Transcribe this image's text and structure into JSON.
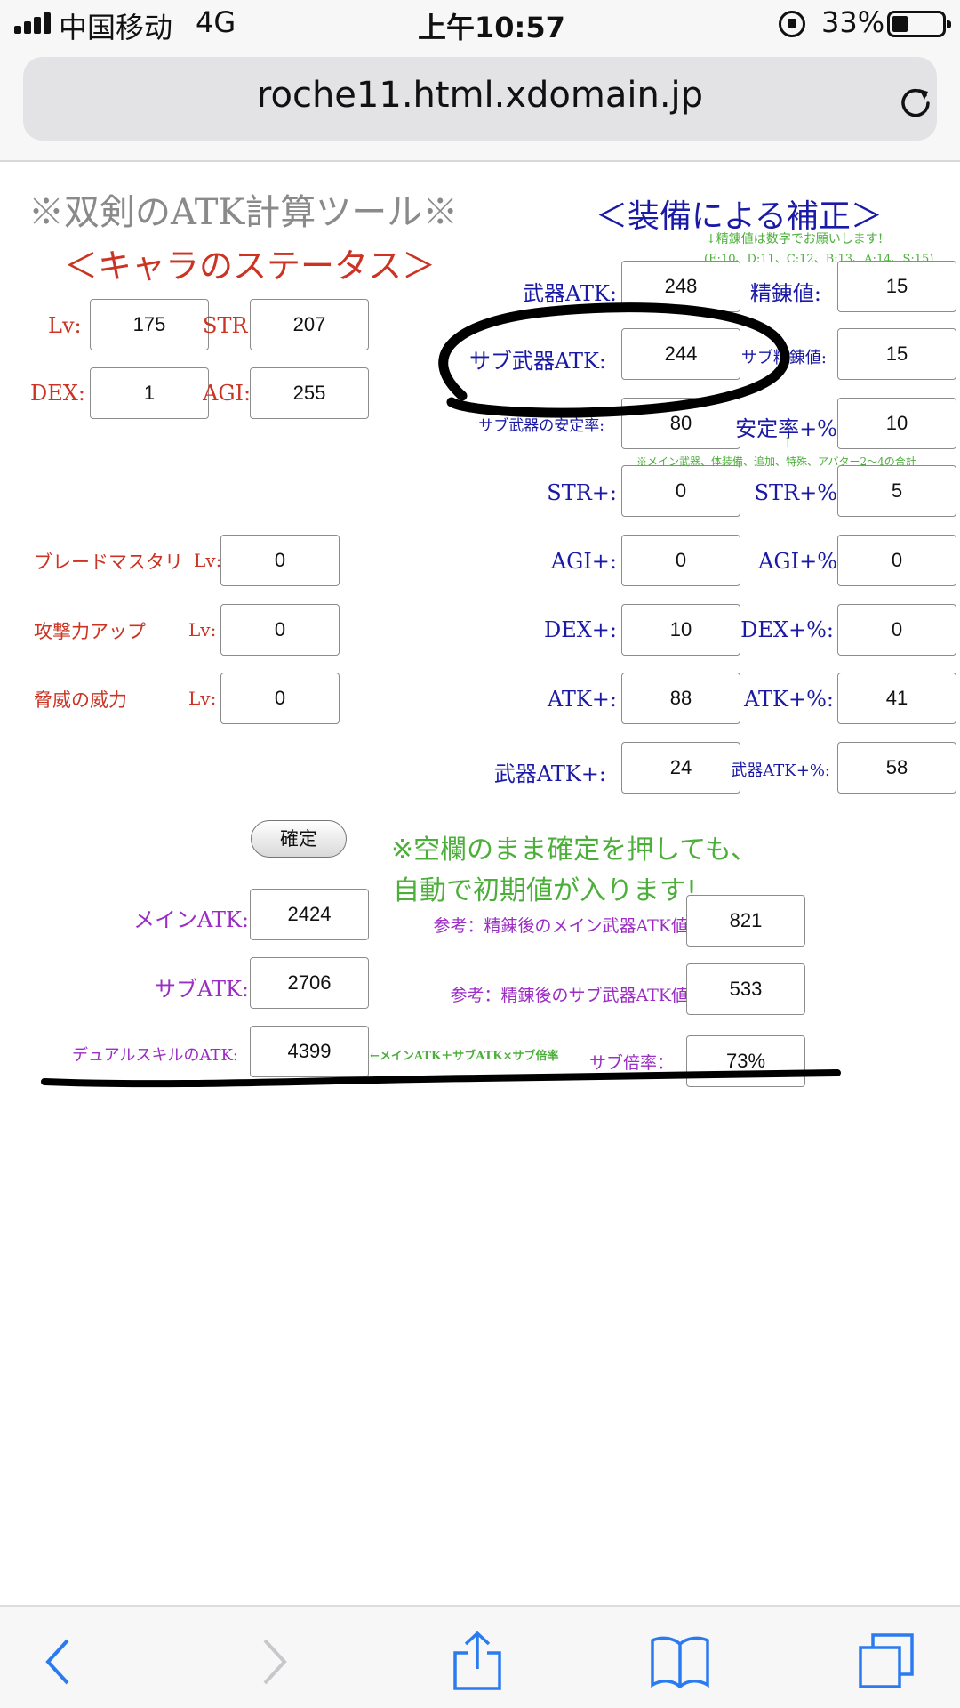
{
  "status": {
    "carrier": "中国移动",
    "network": "4G",
    "time": "上午10:57",
    "battery": "33%"
  },
  "browser": {
    "url": "roche11.html.xdomain.jp"
  },
  "page": {
    "title": "※双剣のATK計算ツール※",
    "char_heading": "＜キャラのステータス＞",
    "equip_heading": "＜装備による補正＞",
    "refine_note_1": "↓精錬値は数字でお願いします!",
    "refine_note_2": "(E:10、D:11、C:12、B:13、A:14、S:15)",
    "stability_note_arrow": "↑",
    "stability_note": "※メイン武器、体装備、追加、特殊、アバター2〜4の合計",
    "empty_note_1": "※空欄のまま確定を押しても、",
    "empty_note_2": "自動で初期値が入ります!",
    "dual_formula": "←メインATK＋サブATK×サブ倍率"
  },
  "character": {
    "lv_label": "Lv:",
    "lv": "175",
    "str_label": "STR:",
    "str": "207",
    "dex_label": "DEX:",
    "dex": "1",
    "agi_label": "AGI:",
    "agi": "255"
  },
  "skills": [
    {
      "name": "ブレードマスタリ",
      "lv_label": "Lv:",
      "value": "0"
    },
    {
      "name": "攻撃力アップ",
      "lv_label": "Lv:",
      "value": "0"
    },
    {
      "name": "脅威の威力",
      "lv_label": "Lv:",
      "value": "0"
    }
  ],
  "equip": {
    "weapon_atk_label": "武器ATK:",
    "weapon_atk": "248",
    "refine_label": "精錬値:",
    "refine": "15",
    "sub_weapon_atk_label": "サブ武器ATK:",
    "sub_weapon_atk": "244",
    "sub_refine_label": "サブ精錬値:",
    "sub_refine": "15",
    "sub_stability_label": "サブ武器の安定率:",
    "sub_stability": "80",
    "stability_pct_label": "安定率+%",
    "stability_pct": "10",
    "str_plus_label": "STR+:",
    "str_plus": "0",
    "str_pct_label": "STR+%",
    "str_pct": "5",
    "agi_plus_label": "AGI+:",
    "agi_plus": "0",
    "agi_pct_label": "AGI+%",
    "agi_pct": "0",
    "dex_plus_label": "DEX+:",
    "dex_plus": "10",
    "dex_pct_label": "DEX+%:",
    "dex_pct": "0",
    "atk_plus_label": "ATK+:",
    "atk_plus": "88",
    "atk_pct_label": "ATK+%:",
    "atk_pct": "41",
    "weapon_atk_plus_label": "武器ATK+:",
    "weapon_atk_plus": "24",
    "weapon_atk_pct_label": "武器ATK+%:",
    "weapon_atk_pct": "58"
  },
  "buttons": {
    "confirm": "確定"
  },
  "results": {
    "main_atk_label": "メインATK:",
    "main_atk": "2424",
    "sub_atk_label": "サブATK:",
    "sub_atk": "2706",
    "dual_atk_label": "デュアルスキルのATK:",
    "dual_atk": "4399",
    "ref_main_label": "参考：精錬後のメイン武器ATK値",
    "ref_main": "821",
    "ref_sub_label": "参考：精錬後のサブ武器ATK値",
    "ref_sub": "533",
    "sub_ratio_label": "サブ倍率：",
    "sub_ratio": "73%"
  },
  "colors": {
    "red": "#cc3322",
    "blue": "#1a1aa6",
    "green": "#4caf3a",
    "purple": "#9b2cc4",
    "annotation": "#000000"
  }
}
